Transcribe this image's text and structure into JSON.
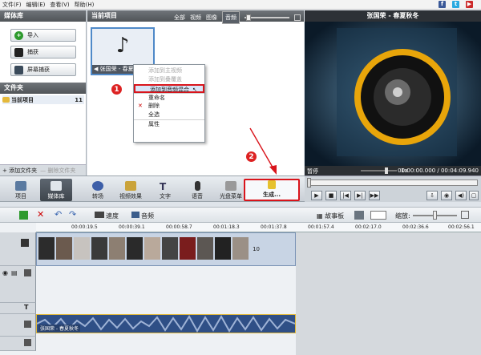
{
  "menu": {
    "file": "文件(F)",
    "edit": "编辑(E)",
    "view": "查看(V)",
    "help": "帮助(H)"
  },
  "left_panel": {
    "title": "媒体库",
    "import": "导入",
    "capture": "捕获",
    "screen_capture": "屏幕捕获",
    "folder_title": "文件夹",
    "folder_item": "当前项目",
    "folder_count": "11",
    "add_folder": "添加文件夹",
    "delete_folder": "删除文件夹"
  },
  "project": {
    "title": "当前项目",
    "tabs": [
      "全部",
      "视频",
      "图像",
      "音频"
    ],
    "clip_name": "张国荣 - 春夏秋冬"
  },
  "context_menu": {
    "items": [
      "添加到主视频",
      "添加到叠覆盖",
      "添加到音频混合",
      "重命名",
      "删除",
      "全选",
      "属性"
    ]
  },
  "preview": {
    "title": "张国荣 - 春夏秋冬",
    "state": "暂停",
    "speed": "1x",
    "time": "00:00:00.000 / 00:04:09.940"
  },
  "toolbar": {
    "items": [
      "项目",
      "媒体库",
      "转场",
      "视频效果",
      "文字",
      "语音",
      "光盘菜单",
      "生成..."
    ]
  },
  "timeline": {
    "speed_label": "速度",
    "audio_label": "音频",
    "storyboard": "故事板",
    "zoom": "缩放:",
    "ruler": [
      "00:00:19.5",
      "00:00:39.1",
      "00:00:58.7",
      "00:01:18.3",
      "00:01:37.8",
      "00:01:57.4",
      "00:02:17.0",
      "00:02:36.6",
      "00:02:56.1"
    ],
    "video_count": "10",
    "audio_clip": "张国荣 - 春夏秋冬"
  },
  "badges": {
    "one": "1",
    "two": "2"
  },
  "colors": {
    "accent": "#d9141b",
    "selected_tab": "#5a6068"
  }
}
